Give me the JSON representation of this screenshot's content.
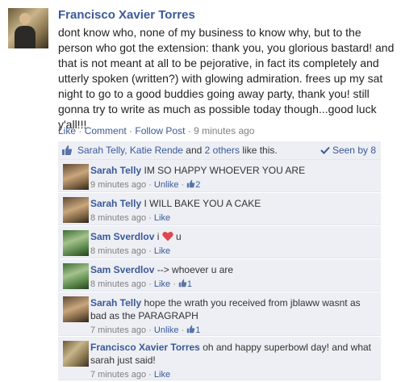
{
  "post": {
    "author": "Francisco Xavier Torres",
    "text": "dont know who, none of my business to know why, but to the person who got the extension: thank you, you glorious bastard! and that is not meant at all to be pejorative, in fact its completely and utterly spoken (written?) with glowing admiration. frees up my sat night to go to a good buddies going away party, thank you! still gonna try to write as much as possible today though...good luck y'all!!!",
    "actions": {
      "like": "Like",
      "comment": "Comment",
      "follow": "Follow Post",
      "timestamp": "9 minutes ago"
    }
  },
  "likes": {
    "names": "Sarah Telly, Katie Rende",
    "and": " and ",
    "others": "2 others",
    "suffix": " like this.",
    "seen_by": "Seen by 8"
  },
  "comments": [
    {
      "author": "Sarah Telly",
      "text": "IM SO HAPPY WHOEVER YOU ARE",
      "time": "9 minutes ago",
      "action": "Unlike",
      "likes": "2"
    },
    {
      "author": "Sarah Telly",
      "text": "I WILL BAKE YOU A CAKE",
      "time": "8 minutes ago",
      "action": "Like"
    },
    {
      "author": "Sam Sverdlov",
      "text_before": "i ",
      "text_after": " u",
      "time": "8 minutes ago",
      "action": "Like"
    },
    {
      "author": "Sam Sverdlov",
      "text": "--> whoever u are",
      "time": "8 minutes ago",
      "action": "Like",
      "likes": "1"
    },
    {
      "author": "Sarah Telly",
      "text": "hope the wrath you received from jblaww wasnt as bad as the PARAGRAPH",
      "time": "7 minutes ago",
      "action": "Unlike",
      "likes": "1"
    },
    {
      "author": "Francisco Xavier Torres",
      "text": "oh and happy superbowl day! and what sarah just said!",
      "time": "7 minutes ago",
      "action": "Like"
    }
  ],
  "separators": {
    "dot": " · "
  },
  "colors": {
    "link": "#3b5998",
    "panel": "#edeff4",
    "heart": "#e0464e"
  },
  "icons": {
    "like": "thumbs-up-icon",
    "seen": "checkmark-icon",
    "heart": "heart-icon"
  }
}
